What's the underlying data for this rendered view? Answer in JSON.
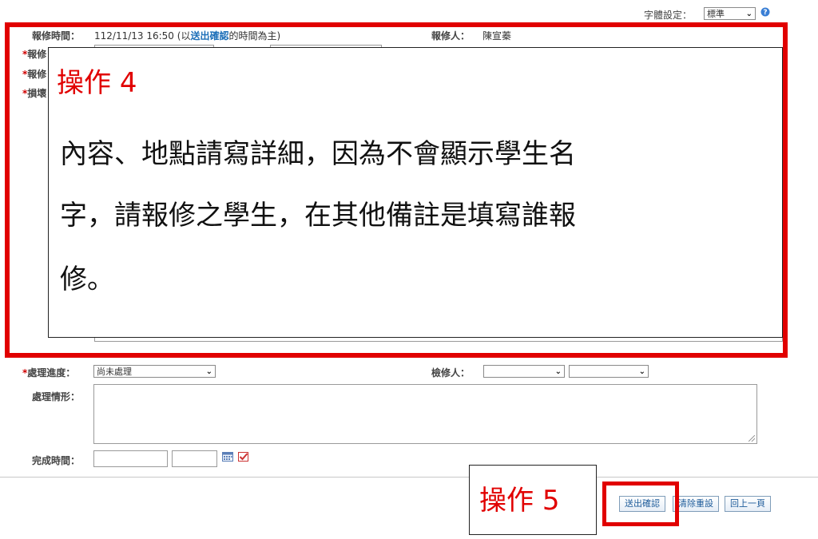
{
  "font_setting": {
    "label": "字體設定：",
    "value": "標準",
    "help_icon": "help-circle-icon"
  },
  "report": {
    "time_label": "報修時間：",
    "time_value": "112/11/13 16:50",
    "time_note_prefix": "(以",
    "time_note_link": "送出確認",
    "time_note_suffix": "的時間為主)",
    "reporter_label": "報修人：",
    "reporter_value": "陳宣蓁",
    "hidden_label_1": "報修",
    "hidden_label_2": "報修",
    "hidden_label_3": "損壞",
    "required_mark": "*"
  },
  "callout4": {
    "title_text": "操作",
    "title_num": "4",
    "lines": [
      "內容、地點請寫詳細，因為不會顯示學生名",
      "字，請報修之學生，在其他備註是填寫誰報",
      "修。"
    ]
  },
  "processing": {
    "progress_label": "處理進度：",
    "progress_value": "尚未處理",
    "inspector_label": "檢修人：",
    "inspector_value_1": "",
    "inspector_value_2": "",
    "situation_label": "處理情形：",
    "completion_label": "完成時間：",
    "calendar_icon": "calendar-icon",
    "check_icon": "checkbox-icon"
  },
  "callout5": {
    "title_text": "操作",
    "title_num": "5"
  },
  "buttons": {
    "submit": "送出確認",
    "reset": "清除重設",
    "back": "回上一頁"
  },
  "colors": {
    "highlight_red": "#e10000",
    "link_blue": "#1d6fb8"
  }
}
